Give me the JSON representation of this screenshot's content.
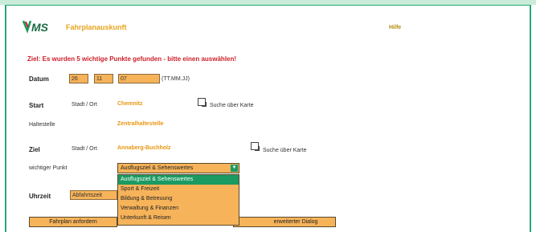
{
  "header": {
    "app_title": "Fahrplanauskunft",
    "help": "Hilfe"
  },
  "message": "Ziel: Es wurden  5 wichtige Punkte gefunden - bitte einen auswählen!",
  "date": {
    "label": "Datum",
    "day": "26",
    "month": "11",
    "year": "07",
    "format": "(TT.MM.JJ)"
  },
  "start": {
    "label": "Start",
    "type": "Stadt / Ort",
    "city": "Chemnitz",
    "map_search": "Suche über Karte",
    "stop_label": "Haltestelle",
    "stop": "Zentralhaltestelle"
  },
  "destination": {
    "label": "Ziel",
    "type": "Stadt / Ort",
    "city": "Annaberg-Buchholz",
    "map_search": "Suche über Karte",
    "poi_label": "wichtiger Punkt",
    "selected": "Ausflugsziel & Sehenswertes",
    "options": [
      "Ausflugsziel & Sehenswertes",
      "Sport & Freizeit",
      "Bildung & Betreuung",
      "Verwaltung & Finanzen",
      "Unterkunft & Reisen"
    ]
  },
  "time": {
    "label": "Uhrzeit",
    "mode": "Abfahrtszeit"
  },
  "buttons": {
    "request": "Fahrplan anfordern",
    "extended": "erweiterter Dialog"
  },
  "colors": {
    "accent_green": "#1b9a62",
    "field_orange": "#f6b35a",
    "error_red": "#cc1f2a"
  }
}
